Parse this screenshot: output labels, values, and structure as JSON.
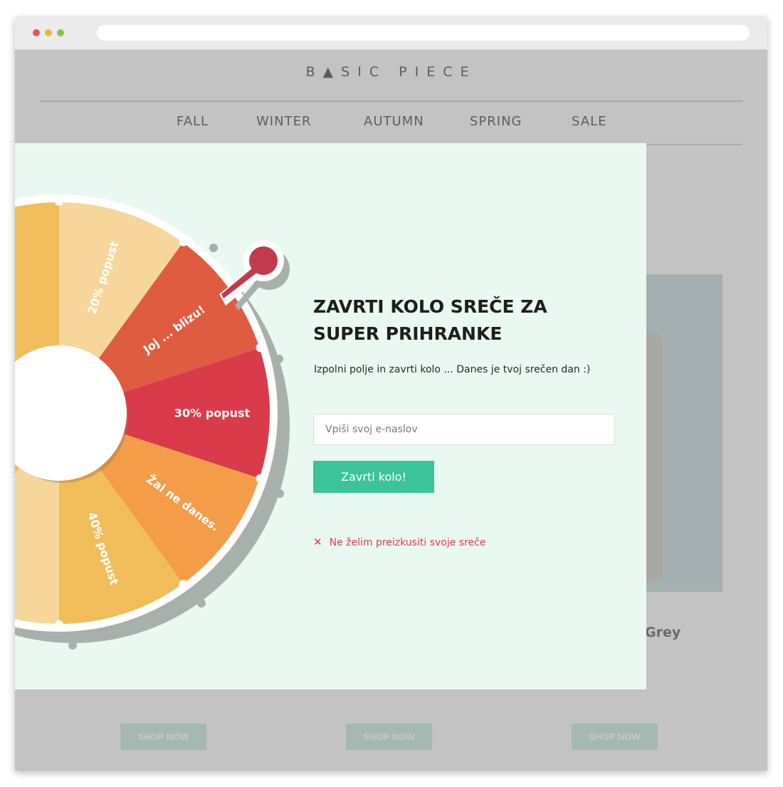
{
  "site": {
    "logo": "B▲SIC PIECE",
    "nav": [
      "FALL",
      "WINTER",
      "AUTUMN",
      "SPRING",
      "SALE"
    ],
    "product_name_fragment": "Grey",
    "shop_button_label": "SHOP NOW"
  },
  "popup": {
    "title": "ZAVRTI KOLO SREČE ZA SUPER PRIHRANKE",
    "subtitle": "Izpolni polje in zavrti kolo ... Danes je tvoj srečen dan :)",
    "email_placeholder": "Vpiši svoj e-naslov",
    "spin_button": "Zavrti kolo!",
    "decline_label": "Ne želim preizkusiti svoje sreče"
  },
  "wheel": {
    "segments": [
      {
        "label": "20% popust",
        "color": "#f6d69b"
      },
      {
        "label": "Joj ... blizu!",
        "color": "#e05c41"
      },
      {
        "label": "30% popust",
        "color": "#da3b4a"
      },
      {
        "label": "Žal ne danes.",
        "color": "#f49d48"
      },
      {
        "label": "40% popust",
        "color": "#f0bd5a"
      }
    ],
    "hidden_segment_colors": [
      "#f6d69b",
      "#f0bd5a"
    ]
  },
  "colors": {
    "accent_green": "#3cc398",
    "decline_red": "#d9414a",
    "pointer": "#c23a4c",
    "modal_bg": "#eaf8f2"
  }
}
